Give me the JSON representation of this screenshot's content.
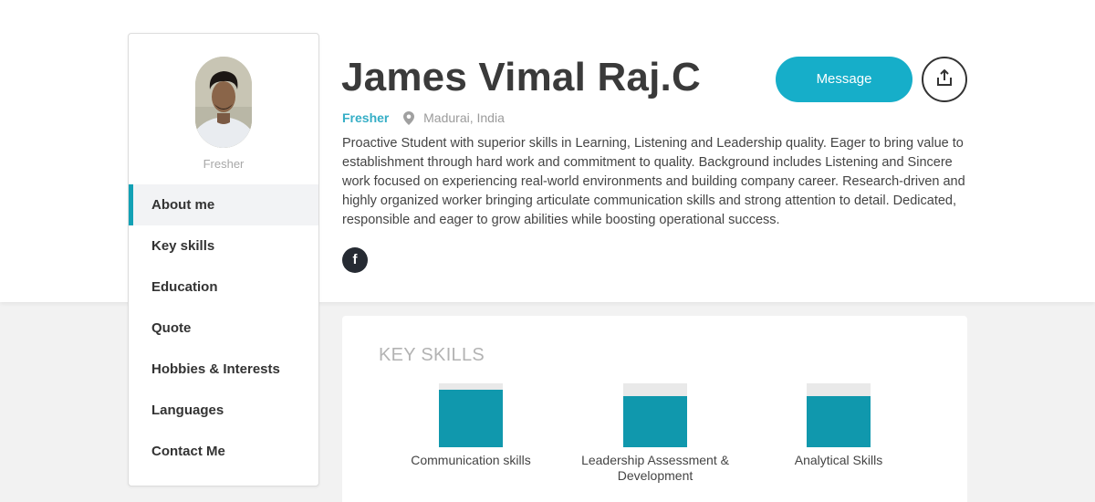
{
  "profile": {
    "name": "James Vimal Raj.C",
    "status": "Fresher",
    "location": "Madurai, India",
    "sidebar_subtitle": "Fresher",
    "about": "Proactive Student with superior skills in Learning, Listening and Leadership quality. Eager to bring value to establishment through hard work and commitment to quality. Background includes Listening and Sincere work focused on experiencing real-world environments and building company career. Research-driven and highly organized worker bringing articulate communication skills and strong attention to detail. Dedicated, responsible and eager to grow abilities while boosting operational success."
  },
  "sidebar": {
    "items": [
      {
        "label": "About me",
        "active": true
      },
      {
        "label": "Key skills"
      },
      {
        "label": "Education"
      },
      {
        "label": "Quote"
      },
      {
        "label": "Hobbies & Interests"
      },
      {
        "label": "Languages"
      },
      {
        "label": "Contact Me"
      }
    ]
  },
  "actions": {
    "message_label": "Message",
    "share_icon": "share-upload-icon"
  },
  "social": {
    "facebook_glyph": "f",
    "facebook_icon": "facebook-icon"
  },
  "skills": {
    "title": "KEY SKILLS",
    "items": [
      {
        "label": "Communication skills",
        "level": 0.9
      },
      {
        "label": "Leadership Assessment & Development",
        "level": 0.8
      },
      {
        "label": "Analytical Skills",
        "level": 0.8
      }
    ]
  },
  "colors": {
    "accent": "#16aec9",
    "status": "#35aec6",
    "skill_bar": "#1098ad",
    "dark": "#262b33"
  }
}
